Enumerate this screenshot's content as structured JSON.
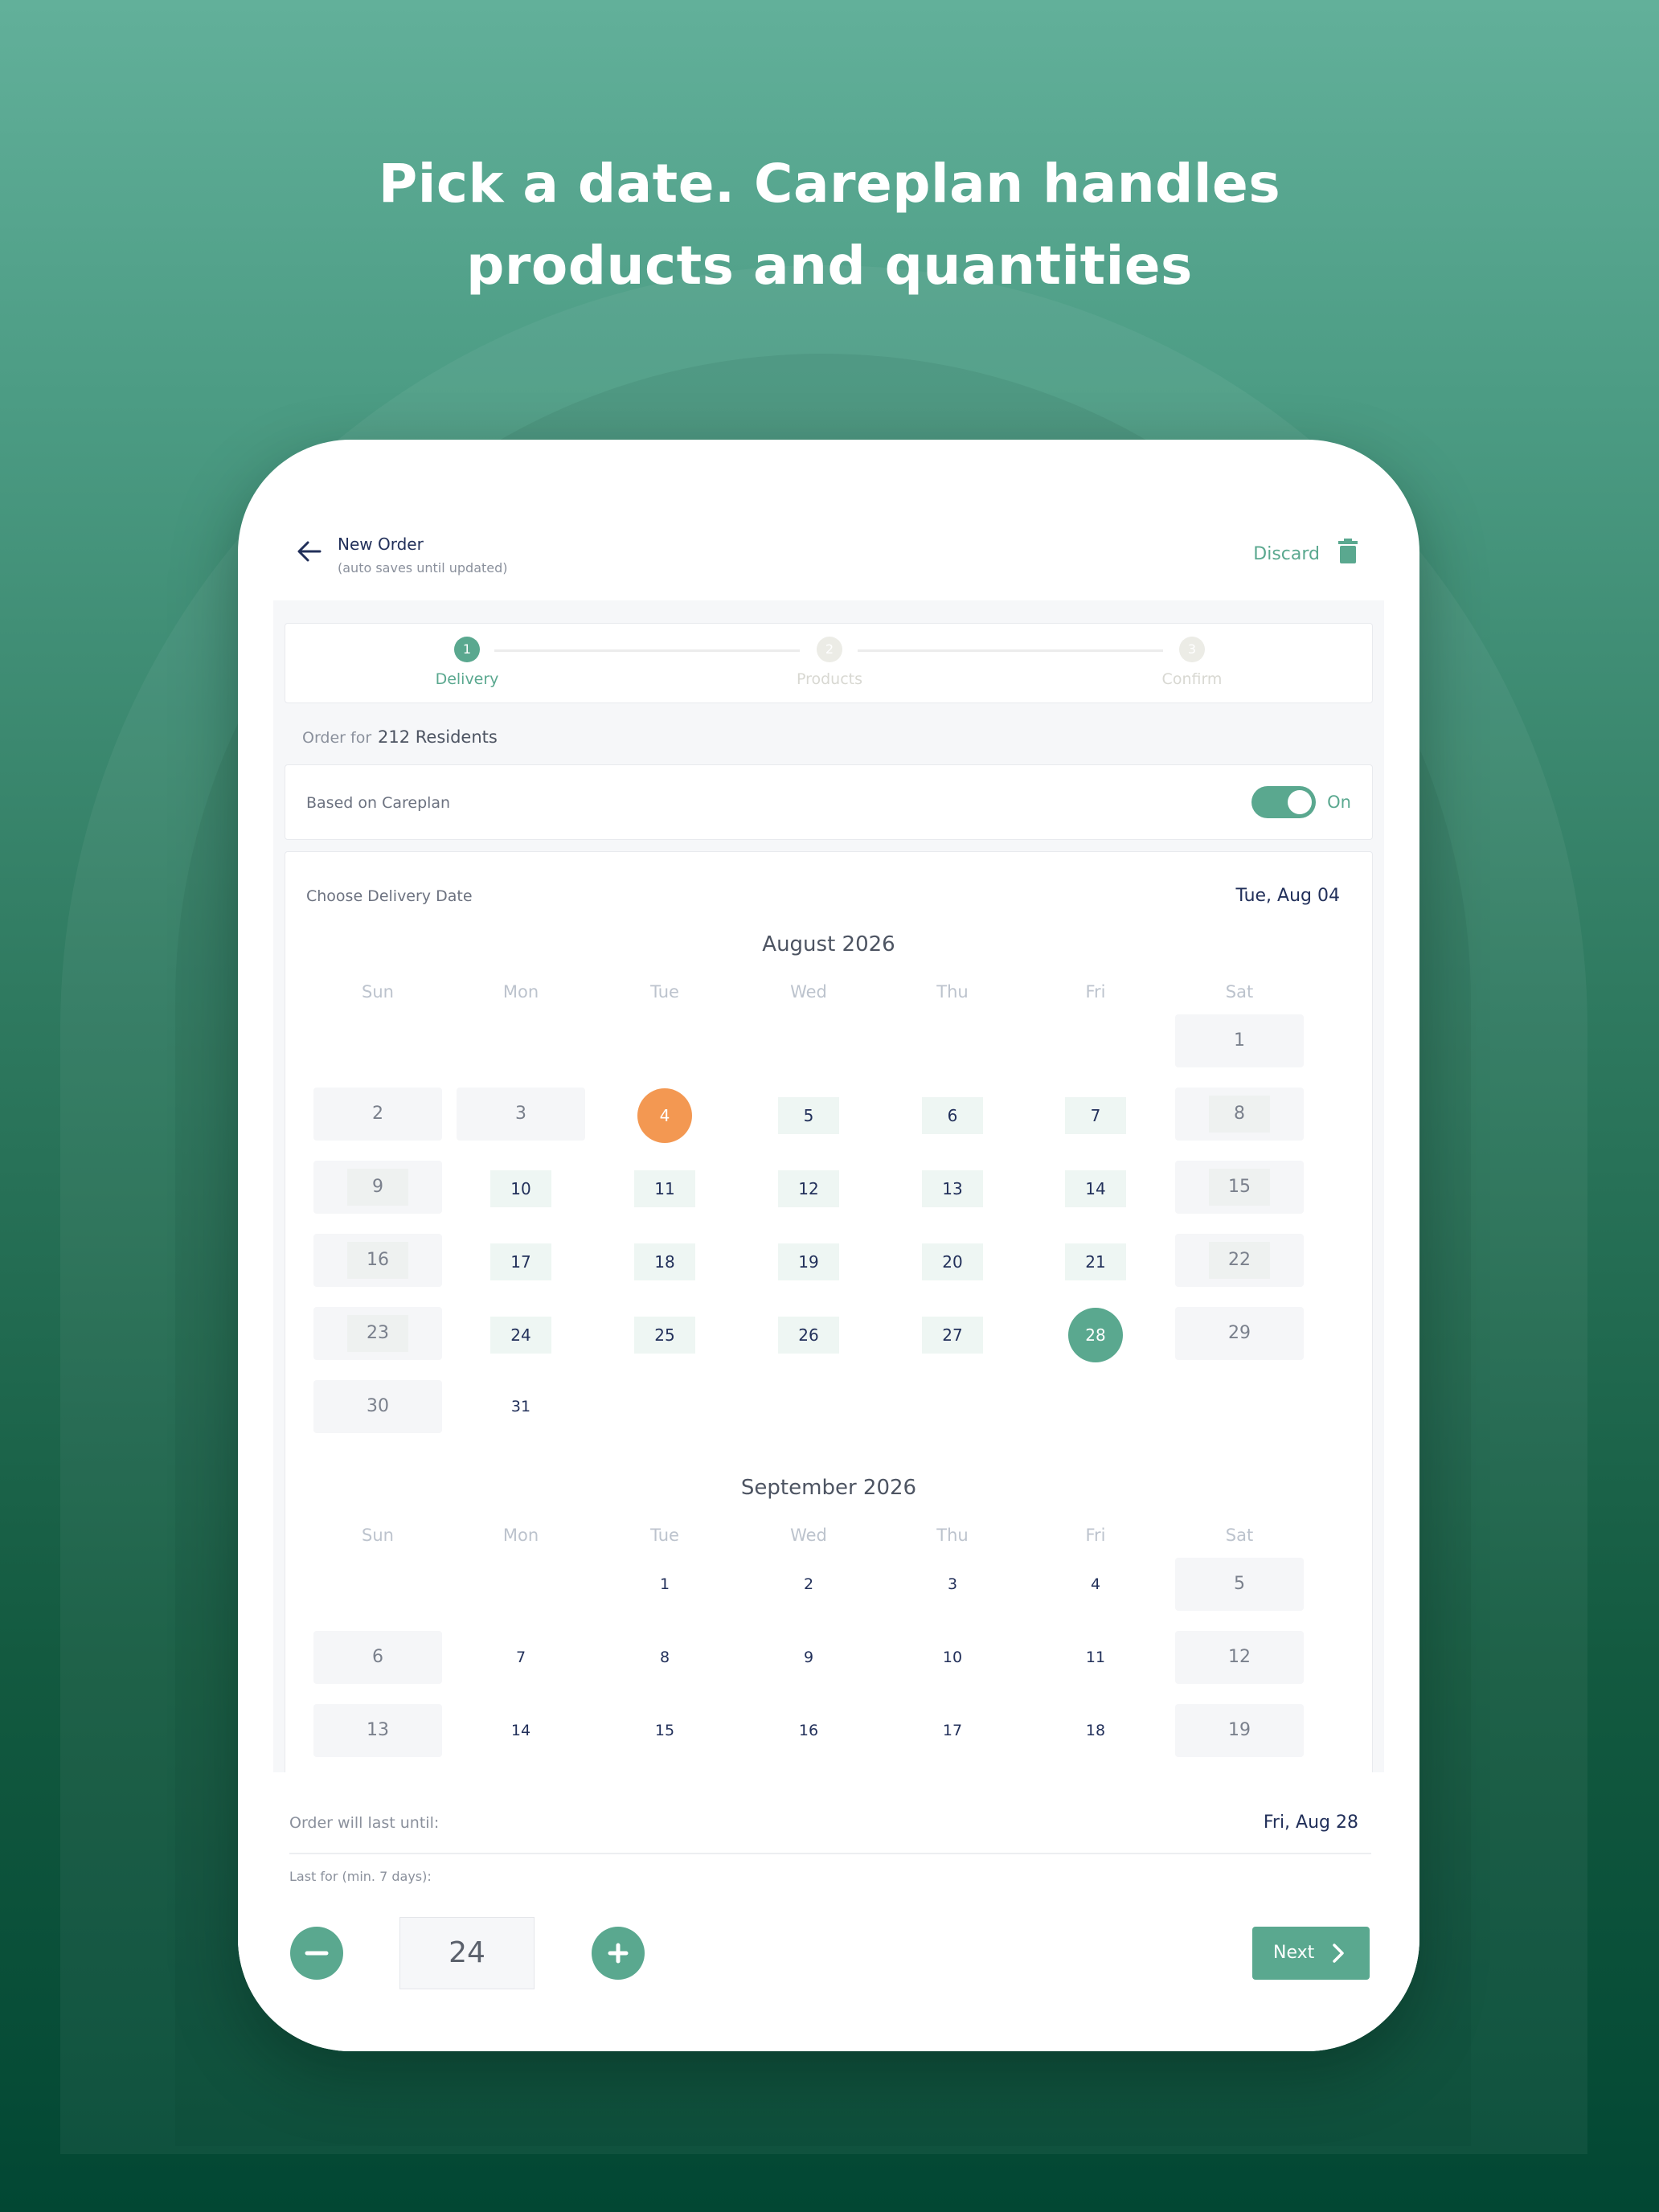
{
  "headline": [
    "Pick a date. Careplan handles",
    "products and quantities"
  ],
  "header": {
    "title": "New Order",
    "subtitle": "(auto saves until updated)",
    "discard_label": "Discard"
  },
  "stepper": [
    {
      "num": "1",
      "label": "Delivery"
    },
    {
      "num": "2",
      "label": "Products"
    },
    {
      "num": "3",
      "label": "Confirm"
    }
  ],
  "order_for": {
    "label": "Order for",
    "value": "212 Residents"
  },
  "careplan": {
    "label": "Based on Careplan",
    "toggle_text": "On"
  },
  "delivery": {
    "label": "Choose Delivery Date",
    "selected": "Tue, Aug 04"
  },
  "weekdays": [
    "Sun",
    "Mon",
    "Tue",
    "Wed",
    "Thu",
    "Fri",
    "Sat"
  ],
  "months": [
    {
      "title": "August 2026",
      "first_weekday": 6,
      "days_shown": 31,
      "past_through": 3,
      "selected_delivery": 4,
      "last_until": 28,
      "available_until": 28
    },
    {
      "title": "September 2026",
      "first_weekday": 2,
      "days_shown": 19,
      "past_through": 0,
      "selected_delivery": 0,
      "last_until": 0,
      "available_until": 0
    }
  ],
  "footer": {
    "last_label": "Order will last until:",
    "last_value": "Fri, Aug 28",
    "lastfor_label": "Last for (min. 7 days):",
    "quantity": "24",
    "next_label": "Next"
  },
  "colors": {
    "accent": "#5aa88f",
    "orange": "#f39852",
    "navy": "#22305a"
  }
}
